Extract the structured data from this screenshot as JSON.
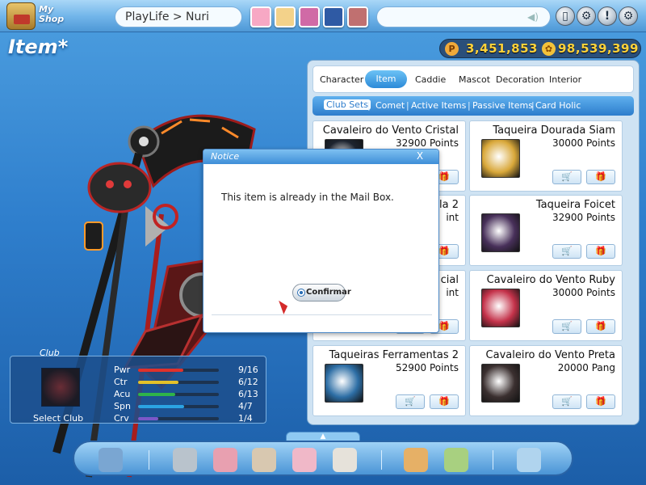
{
  "topbar": {
    "myshop_label": "My Shop",
    "breadcrumb": "PlayLife > Nuri",
    "search": {
      "value": "",
      "placeholder": ""
    },
    "avatars": [
      {
        "name": "avatar-1",
        "color": "#f7a8c4"
      },
      {
        "name": "avatar-2",
        "color": "#f3d28a"
      },
      {
        "name": "avatar-3",
        "color": "#d06aa6"
      },
      {
        "name": "avatar-4",
        "color": "#2f5aa4"
      },
      {
        "name": "avatar-5",
        "color": "#c07070"
      }
    ],
    "icons": [
      "phone-icon",
      "user-settings-icon",
      "info-icon",
      "gear-icon"
    ]
  },
  "page": {
    "title": "Item*"
  },
  "currency": {
    "points_value": "3,451,853",
    "pang_value": "98,539,399",
    "points_icon": "P",
    "pang_icon": "✿"
  },
  "categories": {
    "tabs": [
      "Character",
      "Item",
      "Caddie",
      "Mascot",
      "Decoration",
      "Interior"
    ],
    "active": "Item"
  },
  "subcategories": {
    "tabs": [
      "Club Sets",
      "Comet",
      "Active Items",
      "Passive Items",
      "Card Holic"
    ],
    "active": "Club Sets"
  },
  "items": [
    {
      "name": "Cavaleiro do Vento Cristal",
      "price": "32900 Points",
      "color": "#1d2430"
    },
    {
      "name": "Taqueira Dourada Siam",
      "price": "30000 Points",
      "color": "#d9a83a"
    },
    {
      "name": "la 2",
      "price": "int",
      "color": "#c9c9c9"
    },
    {
      "name": "Taqueira Foicet",
      "price": "32900 Points",
      "color": "#48305a"
    },
    {
      "name": "cial",
      "price": "int",
      "color": "#bdbdbd"
    },
    {
      "name": "Cavaleiro do Vento Ruby",
      "price": "30000 Points",
      "color": "#c4324a"
    },
    {
      "name": "Taqueiras Ferramentas 2",
      "price": "52900 Points",
      "color": "#2d6ea5"
    },
    {
      "name": "Cavaleiro do Vento Preta",
      "price": "20000 Pang",
      "color": "#3b3030"
    }
  ],
  "club": {
    "title": "Club",
    "select_label": "Select Club",
    "stats": [
      {
        "name": "Pwr",
        "value": "9/16",
        "fill": 0.5625,
        "color": "#e0312b"
      },
      {
        "name": "Ctr",
        "value": "6/12",
        "fill": 0.5,
        "color": "#e3c12a"
      },
      {
        "name": "Acu",
        "value": "6/13",
        "fill": 0.46,
        "color": "#2fb34a"
      },
      {
        "name": "Spn",
        "value": "4/7",
        "fill": 0.57,
        "color": "#2ba3e3"
      },
      {
        "name": "Crv",
        "value": "1/4",
        "fill": 0.25,
        "color": "#7b58c8"
      }
    ]
  },
  "notice": {
    "title": "Notice",
    "close_glyph": "X",
    "message": "This item is already in the Mail Box.",
    "confirm_label": "Confirmar"
  },
  "dock": {
    "handle_glyph": "▲",
    "icons": [
      "music-icon",
      "clubhouse-icon",
      "scratch-icon",
      "card-icon",
      "mail-icon",
      "puzzle-icon",
      "house-icon",
      "trade-icon",
      "pet-icon"
    ]
  }
}
